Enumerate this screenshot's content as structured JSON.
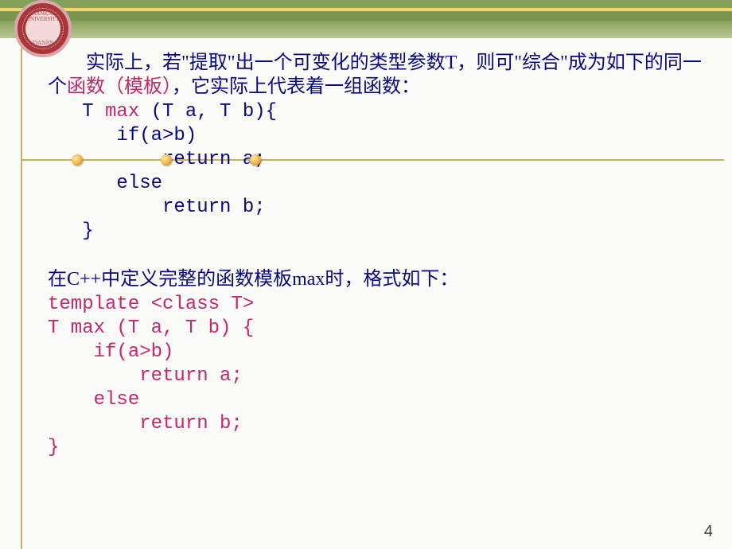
{
  "logo": {
    "top": "NANKAI UNIVERSITY",
    "bottom": "TIANJIN"
  },
  "para1": {
    "pre": "　　实际上，若\"提取\"出一个可变化的类型参数T，则可\"综合\"成为如下的同一个",
    "hl": "函数（模板）",
    "post": "，它实际上代表着一组函数："
  },
  "code1": {
    "func_line_pre": "   T ",
    "func_name": "max",
    "func_line_post": " (T a, T b){",
    "l2": "      if(a>b)",
    "l3": "          return a;",
    "l4": "      else",
    "l5": "          return b;",
    "l6": "   }"
  },
  "para2": {
    "text": "  在C++中定义完整的函数模板max时，格式如下："
  },
  "code2": {
    "l1": "template <class T>",
    "l2": "T max (T a, T b) {",
    "l3": "    if(a>b)",
    "l4": "        return a;",
    "l5": "    else",
    "l6": "        return b;",
    "l7": "}"
  },
  "page_number": "4"
}
